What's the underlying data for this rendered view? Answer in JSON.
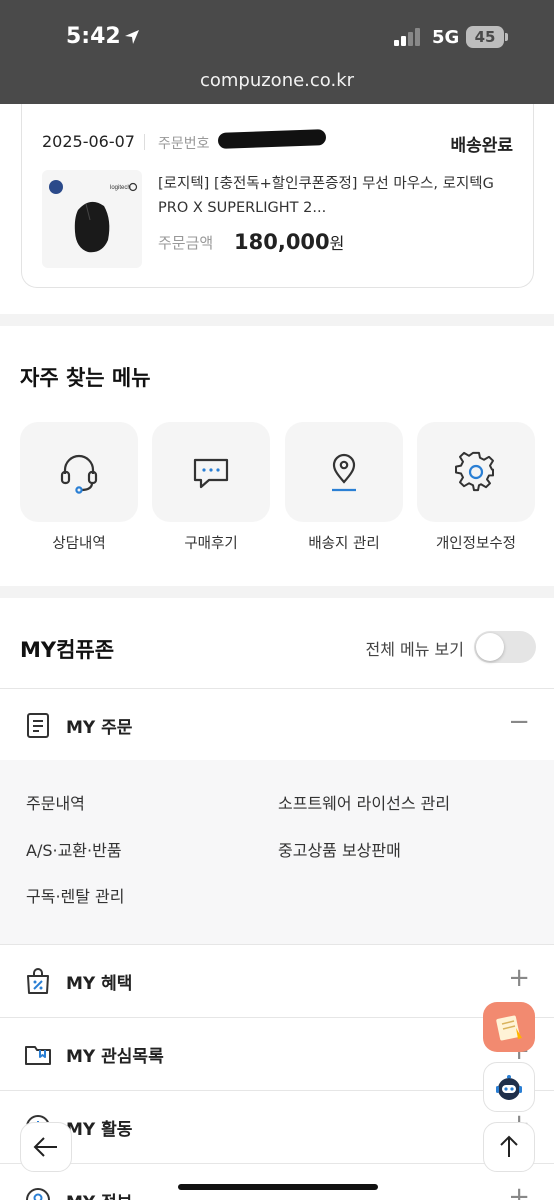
{
  "status": {
    "time": "5:42",
    "network": "5G",
    "battery": "45"
  },
  "browser": {
    "url": "compuzone.co.kr"
  },
  "order": {
    "date": "2025-06-07",
    "order_number_label": "주문번호",
    "status": "배송완료",
    "product_line1": "[로지텍] [충전독+할인쿠폰증정] 무선 마우스, 로지텍G",
    "product_line2": "PRO X SUPERLIGHT 2...",
    "price_label": "주문금액",
    "price": "180,000",
    "price_unit": "원",
    "thumb_brand": "logitech"
  },
  "quick_menu": {
    "title": "자주 찾는 메뉴",
    "items": [
      {
        "label": "상담내역",
        "icon": "headset-icon"
      },
      {
        "label": "구매후기",
        "icon": "chat-icon"
      },
      {
        "label": "배송지 관리",
        "icon": "location-pin-icon"
      },
      {
        "label": "개인정보수정",
        "icon": "gear-icon"
      }
    ]
  },
  "my": {
    "title": "MY컴퓨존",
    "all_menu_label": "전체 메뉴 보기",
    "all_menu_on": false,
    "sections": [
      {
        "label": "MY 주문",
        "icon": "document-icon",
        "expanded": true,
        "sign": "−"
      },
      {
        "label": "MY 혜택",
        "icon": "shopping-bag-percent-icon",
        "sign": "+"
      },
      {
        "label": "MY 관심목록",
        "icon": "folder-icon",
        "sign": "+"
      },
      {
        "label": "MY 활동",
        "icon": "clock-icon",
        "sign": "+"
      },
      {
        "label": "MY 정보",
        "icon": "user-icon",
        "sign": "+"
      }
    ],
    "order_links": [
      "주문내역",
      "소프트웨어 라이선스 관리",
      "A/S·교환·반품",
      "중고상품 보상판매",
      "구독·렌탈 관리"
    ]
  },
  "colors": {
    "accent_blue": "#2a7fd4",
    "float_orange": "#f28a70",
    "topbar": "#4a4a4a"
  }
}
